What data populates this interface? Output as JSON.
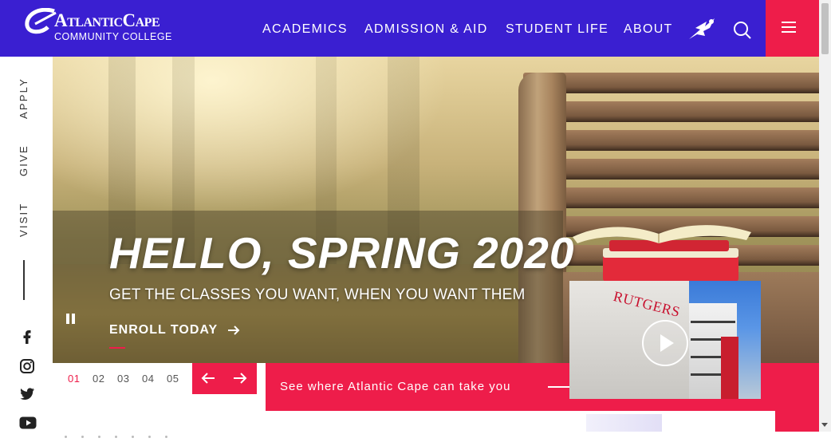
{
  "header": {
    "logo": {
      "main": "AtlanticCape",
      "sub": "COMMUNITY COLLEGE"
    },
    "nav": [
      {
        "label": "ACADEMICS"
      },
      {
        "label": "ADMISSION & AID"
      },
      {
        "label": "STUDENT LIFE"
      },
      {
        "label": "ABOUT"
      }
    ],
    "icons": {
      "hero": "flying-hero-icon",
      "search": "search-icon",
      "menu": "hamburger-menu-icon"
    }
  },
  "rail": {
    "links": [
      {
        "label": "APPLY"
      },
      {
        "label": "GIVE"
      },
      {
        "label": "VISIT"
      }
    ],
    "social": [
      "facebook-icon",
      "instagram-icon",
      "twitter-icon",
      "youtube-icon"
    ]
  },
  "hero": {
    "title": "HELLO, SPRING 2020",
    "subtitle": "GET THE CLASSES YOU WANT, WHEN YOU WANT THEM",
    "cta_label": "ENROLL TODAY"
  },
  "slides": {
    "numbers": [
      "01",
      "02",
      "03",
      "04",
      "05"
    ],
    "active": "01"
  },
  "banner": {
    "text": "See where Atlantic Cape can take you",
    "video_sign": "RUTGERS"
  },
  "colors": {
    "brand_purple": "#3a1fd1",
    "accent_red": "#ee1d4a"
  }
}
